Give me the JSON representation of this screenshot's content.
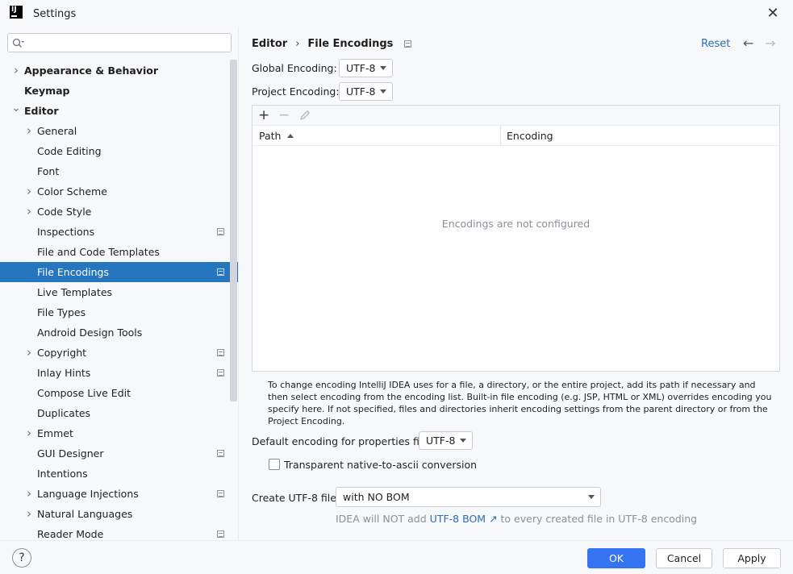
{
  "window": {
    "title": "Settings",
    "logo_text": "IJ"
  },
  "sidebar": {
    "search": {
      "placeholder": ""
    },
    "items": [
      {
        "label": "Appearance & Behavior",
        "level": 0,
        "bold": true,
        "expandable": true,
        "expanded": false,
        "project_icon": false,
        "selected": false
      },
      {
        "label": "Keymap",
        "level": 0,
        "bold": true,
        "expandable": false,
        "expanded": false,
        "project_icon": false,
        "selected": false
      },
      {
        "label": "Editor",
        "level": 0,
        "bold": true,
        "expandable": true,
        "expanded": true,
        "project_icon": false,
        "selected": false
      },
      {
        "label": "General",
        "level": 1,
        "bold": false,
        "expandable": true,
        "expanded": false,
        "project_icon": false,
        "selected": false
      },
      {
        "label": "Code Editing",
        "level": 1,
        "bold": false,
        "expandable": false,
        "expanded": false,
        "project_icon": false,
        "selected": false
      },
      {
        "label": "Font",
        "level": 1,
        "bold": false,
        "expandable": false,
        "expanded": false,
        "project_icon": false,
        "selected": false
      },
      {
        "label": "Color Scheme",
        "level": 1,
        "bold": false,
        "expandable": true,
        "expanded": false,
        "project_icon": false,
        "selected": false
      },
      {
        "label": "Code Style",
        "level": 1,
        "bold": false,
        "expandable": true,
        "expanded": false,
        "project_icon": false,
        "selected": false
      },
      {
        "label": "Inspections",
        "level": 1,
        "bold": false,
        "expandable": false,
        "expanded": false,
        "project_icon": true,
        "selected": false
      },
      {
        "label": "File and Code Templates",
        "level": 1,
        "bold": false,
        "expandable": false,
        "expanded": false,
        "project_icon": false,
        "selected": false
      },
      {
        "label": "File Encodings",
        "level": 1,
        "bold": false,
        "expandable": false,
        "expanded": false,
        "project_icon": true,
        "selected": true
      },
      {
        "label": "Live Templates",
        "level": 1,
        "bold": false,
        "expandable": false,
        "expanded": false,
        "project_icon": false,
        "selected": false
      },
      {
        "label": "File Types",
        "level": 1,
        "bold": false,
        "expandable": false,
        "expanded": false,
        "project_icon": false,
        "selected": false
      },
      {
        "label": "Android Design Tools",
        "level": 1,
        "bold": false,
        "expandable": false,
        "expanded": false,
        "project_icon": false,
        "selected": false
      },
      {
        "label": "Copyright",
        "level": 1,
        "bold": false,
        "expandable": true,
        "expanded": false,
        "project_icon": true,
        "selected": false
      },
      {
        "label": "Inlay Hints",
        "level": 1,
        "bold": false,
        "expandable": false,
        "expanded": false,
        "project_icon": true,
        "selected": false
      },
      {
        "label": "Compose Live Edit",
        "level": 1,
        "bold": false,
        "expandable": false,
        "expanded": false,
        "project_icon": false,
        "selected": false
      },
      {
        "label": "Duplicates",
        "level": 1,
        "bold": false,
        "expandable": false,
        "expanded": false,
        "project_icon": false,
        "selected": false
      },
      {
        "label": "Emmet",
        "level": 1,
        "bold": false,
        "expandable": true,
        "expanded": false,
        "project_icon": false,
        "selected": false
      },
      {
        "label": "GUI Designer",
        "level": 1,
        "bold": false,
        "expandable": false,
        "expanded": false,
        "project_icon": true,
        "selected": false
      },
      {
        "label": "Intentions",
        "level": 1,
        "bold": false,
        "expandable": false,
        "expanded": false,
        "project_icon": false,
        "selected": false
      },
      {
        "label": "Language Injections",
        "level": 1,
        "bold": false,
        "expandable": true,
        "expanded": false,
        "project_icon": true,
        "selected": false
      },
      {
        "label": "Natural Languages",
        "level": 1,
        "bold": false,
        "expandable": true,
        "expanded": false,
        "project_icon": false,
        "selected": false
      },
      {
        "label": "Reader Mode",
        "level": 1,
        "bold": false,
        "expandable": false,
        "expanded": false,
        "project_icon": true,
        "selected": false
      }
    ]
  },
  "header": {
    "breadcrumb": [
      "Editor",
      "File Encodings"
    ],
    "separator": "›",
    "reset_label": "Reset",
    "back_icon": "arrow-left-icon",
    "forward_icon": "arrow-right-icon"
  },
  "form": {
    "global_encoding_label": "Global Encoding:",
    "global_encoding_value": "UTF-8",
    "project_encoding_label": "Project Encoding:",
    "project_encoding_value": "UTF-8",
    "table": {
      "add_label": "+",
      "remove_label": "−",
      "edit_icon": "pencil-icon",
      "columns": [
        "Path",
        "Encoding"
      ],
      "rows": [],
      "empty_text": "Encodings are not configured"
    },
    "help_text": "To change encoding IntelliJ IDEA uses for a file, a directory, or the entire project, add its path if necessary and then select encoding from the encoding list. Built-in file encoding (e.g. JSP, HTML or XML) overrides encoding you specify here. If not specified, files and directories inherit encoding settings from the parent directory or from the Project Encoding.",
    "properties_encoding_label": "Default encoding for properties files:",
    "properties_encoding_value": "UTF-8",
    "transparent_label": "Transparent native-to-ascii conversion",
    "transparent_checked": false,
    "bom_label": "Create UTF-8 files:",
    "bom_value": "with NO BOM",
    "bom_hint_prefix": "IDEA will NOT add",
    "bom_hint_link": "UTF-8 BOM",
    "bom_hint_arrow": "↗",
    "bom_hint_suffix": "to every created file in UTF-8 encoding"
  },
  "footer": {
    "help_label": "?",
    "ok_label": "OK",
    "cancel_label": "Cancel",
    "apply_label": "Apply"
  },
  "colors": {
    "accent": "#3574f0",
    "selection": "#2675bf",
    "link": "#2d6bb5",
    "background": "#f7f8fa"
  }
}
